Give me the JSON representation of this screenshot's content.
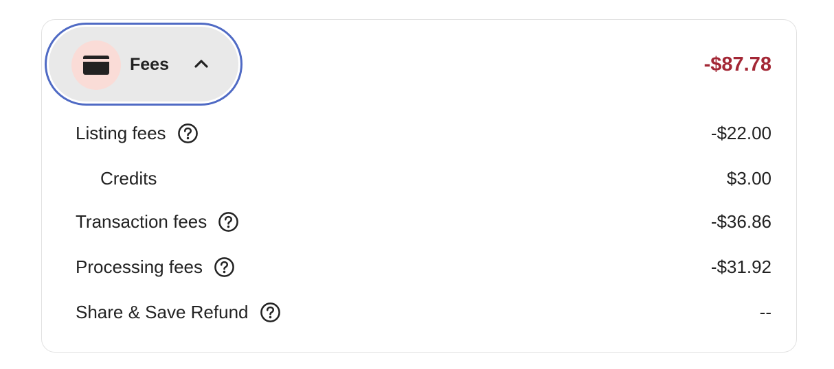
{
  "fees": {
    "toggle_label": "Fees",
    "toggle_icon": "credit-card-icon",
    "expanded_icon": "chevron-up-icon",
    "total": "-$87.78",
    "total_color": "#a32735",
    "focus_ring_color": "#4f6ac4",
    "items": [
      {
        "label": "Listing fees",
        "amount": "-$22.00",
        "help_icon": "help-icon"
      },
      {
        "label": "Credits",
        "amount": "$3.00"
      },
      {
        "label": "Transaction fees",
        "amount": "-$36.86",
        "help_icon": "help-icon"
      },
      {
        "label": "Processing fees",
        "amount": "-$31.92",
        "help_icon": "help-icon"
      },
      {
        "label": "Share & Save Refund",
        "amount": "--",
        "help_icon": "help-icon"
      }
    ]
  }
}
